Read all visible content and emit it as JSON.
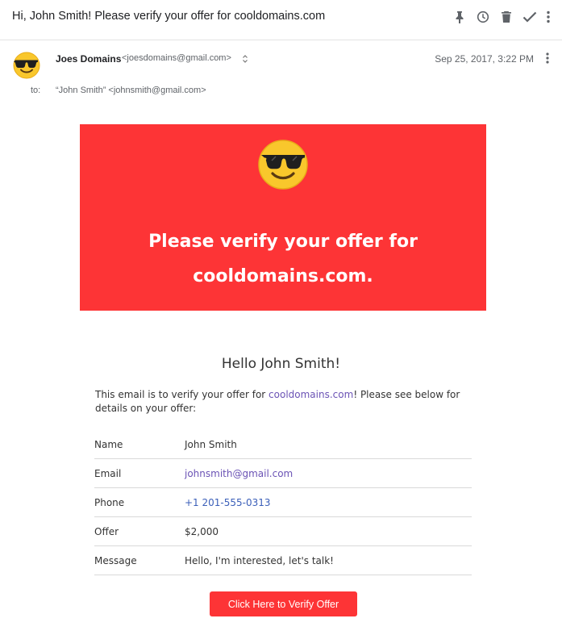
{
  "email": {
    "subject": "Hi, John Smith! Please verify your offer for cooldomains.com"
  },
  "toolbar": {
    "icons": [
      "pin-icon",
      "snooze-icon",
      "delete-icon",
      "done-icon",
      "more-vert-icon"
    ]
  },
  "sender": {
    "name": "Joes Domains",
    "email": "<joesdomains@gmail.com>",
    "date": "Sep 25, 2017, 3:22 PM",
    "to_label": "to:",
    "to_value": "“John Smith” <johnsmith@gmail.com>"
  },
  "body": {
    "hero_title_line1": "Please verify your offer for",
    "hero_title_line2": "cooldomains.com.",
    "hello": "Hello John Smith!",
    "intro_before": "This email is to verify your offer for ",
    "intro_link": "cooldomains.com",
    "intro_after": "! Please see below for details on your offer:",
    "details": [
      {
        "label": "Name",
        "value": "John Smith"
      },
      {
        "label": "Email",
        "value": "johnsmith@gmail.com"
      },
      {
        "label": "Phone",
        "value": "+1 201-555-0313"
      },
      {
        "label": "Offer",
        "value": "$2,000"
      },
      {
        "label": "Message",
        "value": "Hello, I'm interested, let's talk!"
      }
    ],
    "cta": "Click Here to Verify Offer"
  },
  "colors": {
    "accent_red": "#fd3436",
    "link_purple": "#6b53b5",
    "link_blue": "#3b5fb9"
  }
}
